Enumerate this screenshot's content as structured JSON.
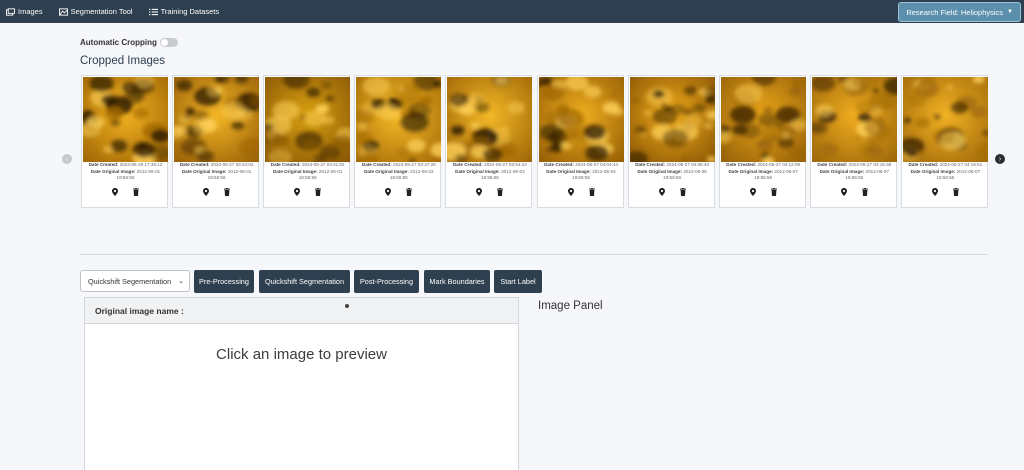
{
  "nav": {
    "items": [
      {
        "label": "Images",
        "icon": "images-icon"
      },
      {
        "label": "Segmentation Tool",
        "icon": "segmentation-icon"
      },
      {
        "label": "Training Datasets",
        "icon": "list-icon"
      }
    ],
    "research_field": "Research Field: Heliophysics"
  },
  "auto_cropping": {
    "label": "Automatic Cropping",
    "enabled": false
  },
  "cropped_images": {
    "title": "Cropped Images",
    "created_prefix": "Date Created:",
    "original_prefix": "Date Original Image:",
    "cards": [
      {
        "created": "2024-06-28 17:36:12",
        "original_date": "2012-06-01",
        "original_time": "19:56:56"
      },
      {
        "created": "2024-06-27 03:24:02",
        "original_date": "2012-06-01",
        "original_time": "19:56:56"
      },
      {
        "created": "2024-06-27 03:41:02",
        "original_date": "2012-06-01",
        "original_time": "19:56:56"
      },
      {
        "created": "2024-06-27 03:47:28",
        "original_date": "2012-06-02",
        "original_time": "19:56:56"
      },
      {
        "created": "2024-06-27 03:54:24",
        "original_date": "2012-06-03",
        "original_time": "19:56:56"
      },
      {
        "created": "2024-06-27 04:04:44",
        "original_date": "2012-06-04",
        "original_time": "19:56:56"
      },
      {
        "created": "2024-06-27 04:08:40",
        "original_date": "2012-06-06",
        "original_time": "19:56:56"
      },
      {
        "created": "2024-06-27 04:12:08",
        "original_date": "2012-06-07",
        "original_time": "19:56:56"
      },
      {
        "created": "2024-06-27 04:15:38",
        "original_date": "2012-06-07",
        "original_time": "19:56:56"
      },
      {
        "created": "2024-06-27 04:16:51",
        "original_date": "2012-06-07",
        "original_time": "19:56:56"
      }
    ]
  },
  "toolbar": {
    "select_value": "Quickshift Segementation",
    "buttons": [
      "Pre-Processing",
      "Quickshift Segmentation",
      "Post-Processing",
      "Mark Boundaries",
      "Start Label"
    ]
  },
  "preview": {
    "header": "Original image name :",
    "placeholder": "Click an image to preview"
  },
  "image_panel": {
    "title": "Image Panel"
  }
}
